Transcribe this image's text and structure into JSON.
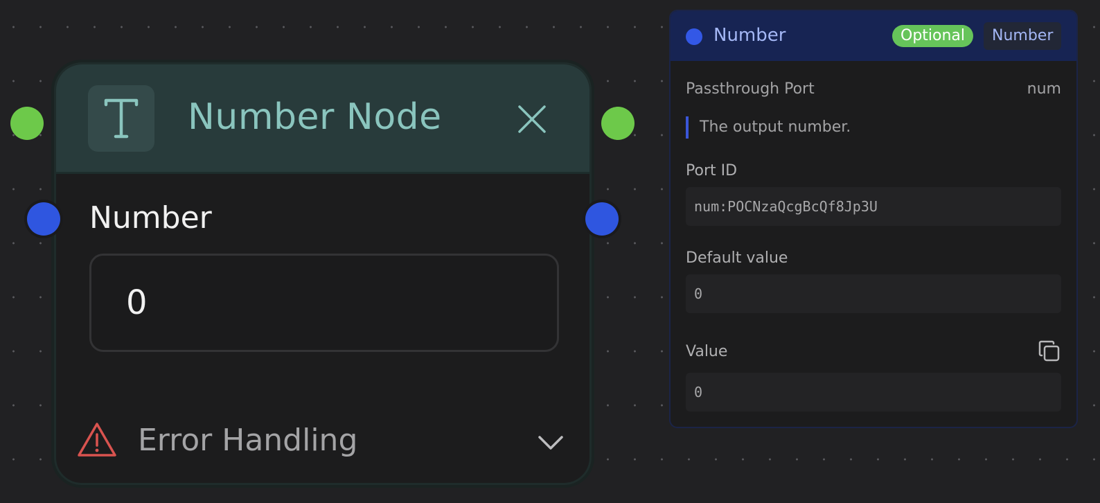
{
  "node": {
    "title": "Number Node",
    "icon": "text-t-icon",
    "port_label": "Number",
    "input_value": "0",
    "error_handling_label": "Error Handling"
  },
  "panel": {
    "title": "Number",
    "badge_optional": "Optional",
    "badge_type": "Number",
    "passthrough_label": "Passthrough Port",
    "passthrough_id": "num",
    "description": "The output number.",
    "port_id_label": "Port ID",
    "port_id_value": "num:POCNzaQcgBcQf8Jp3U",
    "default_value_label": "Default value",
    "default_value": "0",
    "value_label": "Value",
    "value": "0"
  },
  "colors": {
    "canvas_bg": "#212123",
    "node_header_bg": "#283b3b",
    "node_title": "#8ac5be",
    "exec_port": "#6dc94a",
    "data_port": "#2f56e0",
    "panel_header_bg": "#172453",
    "optional_badge": "#66c45a",
    "warning": "#d9534f"
  }
}
